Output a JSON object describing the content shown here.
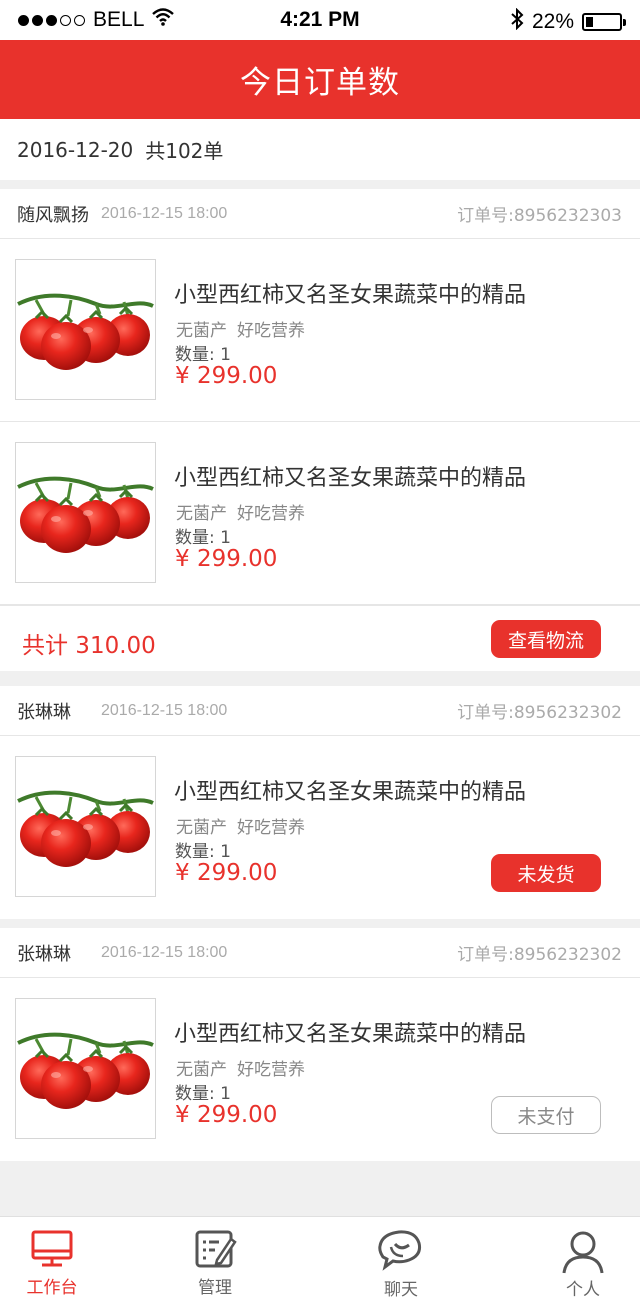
{
  "status_bar": {
    "carrier": "BELL",
    "time": "4:21 PM",
    "battery": "22%",
    "battery_level": 0.22
  },
  "header": {
    "title": "今日订单数"
  },
  "summary": {
    "date": "2016-12-20",
    "count": "共102单"
  },
  "orders": [
    {
      "buyer": "随风飘扬",
      "time": "2016-12-15  18:00",
      "order_no": "订单号:8956232303",
      "items": [
        {
          "title": "小型西红柿又名圣女果蔬菜中的精品",
          "tag1": "无菌产",
          "tag2": "好吃营养",
          "qty": "数量: 1",
          "price": "¥  299.00"
        },
        {
          "title": "小型西红柿又名圣女果蔬菜中的精品",
          "tag1": "无菌产",
          "tag2": "好吃营养",
          "qty": "数量: 1",
          "price": "¥  299.00"
        }
      ],
      "total": "共计 310.00",
      "action": "查看物流"
    },
    {
      "buyer": "张琳琳",
      "time": "2016-12-15  18:00",
      "order_no": "订单号:8956232302",
      "items": [
        {
          "title": "小型西红柿又名圣女果蔬菜中的精品",
          "tag1": "无菌产",
          "tag2": "好吃营养",
          "qty": "数量: 1",
          "price": "¥  299.00"
        }
      ],
      "action": "未发货"
    },
    {
      "buyer": "张琳琳",
      "time": "2016-12-15  18:00",
      "order_no": "订单号:8956232302",
      "items": [
        {
          "title": "小型西红柿又名圣女果蔬菜中的精品",
          "tag1": "无菌产",
          "tag2": "好吃营养",
          "qty": "数量: 1",
          "price": "¥  299.00"
        }
      ],
      "action": "未支付"
    }
  ],
  "tabbar": {
    "tabs": [
      {
        "label": "工作台",
        "icon": "monitor-icon",
        "active": true
      },
      {
        "label": "管理",
        "icon": "edit-list-icon",
        "active": false
      },
      {
        "label": "聊天",
        "icon": "chat-bubble-icon",
        "active": false
      },
      {
        "label": "个人",
        "icon": "person-icon",
        "active": false
      }
    ]
  },
  "colors": {
    "accent": "#e8322c",
    "background": "#f0f0f0",
    "muted_text": "#aaaaaa"
  }
}
